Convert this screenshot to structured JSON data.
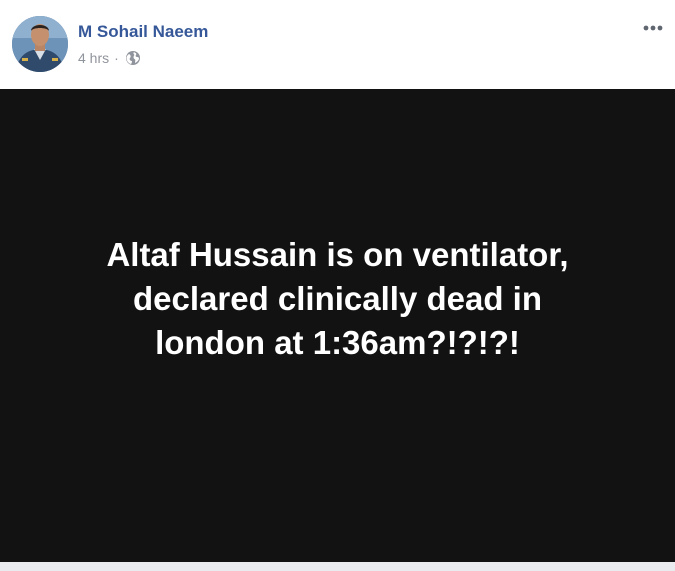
{
  "post": {
    "author": "M Sohail Naeem",
    "timestamp": "4 hrs",
    "separator": "·",
    "privacy_icon": "globe-icon",
    "options_icon": "more-options-icon",
    "image_text_lines": [
      "Altaf Hussain is on ventilator,",
      "declared clinically dead in",
      "london at 1:36am?!?!?!"
    ]
  },
  "colors": {
    "author_link": "#365899",
    "meta_text": "#90949c",
    "image_background": "#121212",
    "image_text": "#ffffff"
  }
}
